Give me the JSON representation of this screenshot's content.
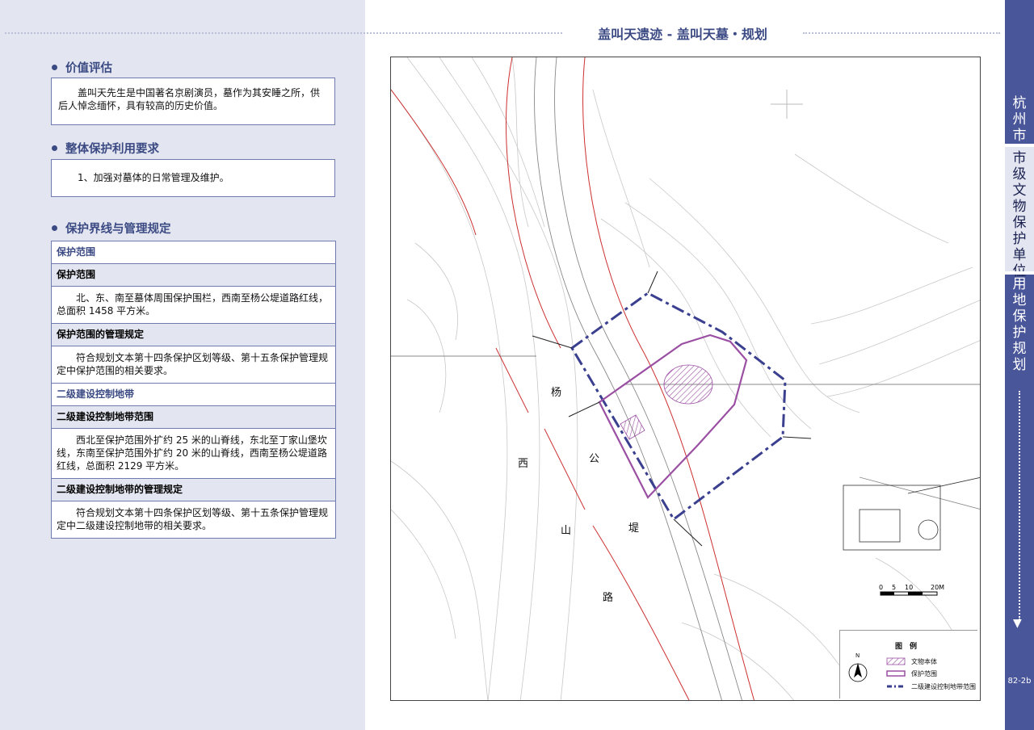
{
  "header": {
    "title": "盖叫天遗迹 - 盖叫天墓・规划"
  },
  "sections": {
    "value": {
      "heading": "价值评估",
      "text": "盖叫天先生是中国著名京剧演员，墓作为其安睡之所，供后人悼念缅怀，具有较高的历史价值。"
    },
    "overall": {
      "heading": "整体保护利用要求",
      "text": "1、加强对墓体的日常管理及维护。"
    },
    "boundary": {
      "heading": "保护界线与管理规定",
      "rows": [
        {
          "type": "hdr",
          "text": "保护范围"
        },
        {
          "type": "sub",
          "text": "保护范围"
        },
        {
          "type": "txt",
          "text": "北、东、南至墓体周围保护围栏，西南至杨公堤道路红线，总面积 1458 平方米。"
        },
        {
          "type": "sub",
          "text": "保护范围的管理规定"
        },
        {
          "type": "txt",
          "text": "符合规划文本第十四条保护区划等级、第十五条保护管理规定中保护范围的相关要求。"
        },
        {
          "type": "hdr",
          "text": "二级建设控制地带"
        },
        {
          "type": "sub",
          "text": "二级建设控制地带范围"
        },
        {
          "type": "txt",
          "text": "西北至保护范围外扩约 25 米的山脊线，东北至丁家山堡坎线，东南至保护范围外扩约 20 米的山脊线，西南至杨公堤道路红线，总面积 2129 平方米。"
        },
        {
          "type": "sub",
          "text": "二级建设控制地带的管理规定"
        },
        {
          "type": "txt",
          "text": "符合规划文本第十四条保护区划等级、第十五条保护管理规定中二级建设控制地带的相关要求。"
        }
      ]
    }
  },
  "sidebar": {
    "city": "杭州市",
    "category": "市级文物保护单位",
    "section": "用地保护规划",
    "arrow": "▼",
    "page": "82-2b"
  },
  "map": {
    "road_chars": [
      "杨",
      "公",
      "堤",
      "西",
      "山",
      "路"
    ],
    "scale": {
      "labels": [
        "0",
        "5",
        "10",
        "20M"
      ]
    },
    "north": "N",
    "legend": {
      "title": "图　例",
      "items": [
        {
          "label": "文物本体"
        },
        {
          "label": "保护范围"
        },
        {
          "label": "二级建设控制地带范围"
        }
      ]
    },
    "colors": {
      "protect": "#9b4fa3",
      "control": "#3a3f8f",
      "road": "#cc3030"
    }
  }
}
